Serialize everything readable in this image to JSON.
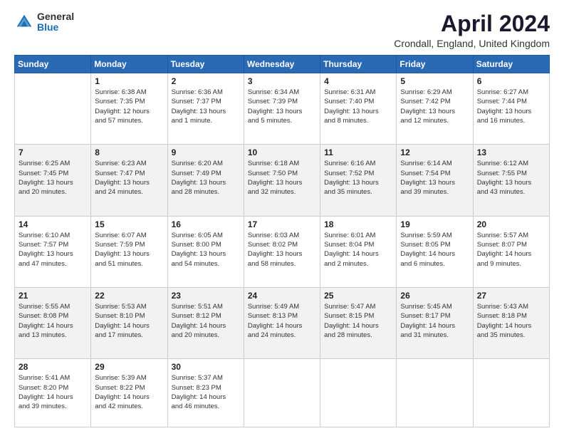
{
  "header": {
    "logo_general": "General",
    "logo_blue": "Blue",
    "title": "April 2024",
    "location": "Crondall, England, United Kingdom"
  },
  "weekdays": [
    "Sunday",
    "Monday",
    "Tuesday",
    "Wednesday",
    "Thursday",
    "Friday",
    "Saturday"
  ],
  "weeks": [
    [
      {
        "day": "",
        "info": ""
      },
      {
        "day": "1",
        "info": "Sunrise: 6:38 AM\nSunset: 7:35 PM\nDaylight: 12 hours\nand 57 minutes."
      },
      {
        "day": "2",
        "info": "Sunrise: 6:36 AM\nSunset: 7:37 PM\nDaylight: 13 hours\nand 1 minute."
      },
      {
        "day": "3",
        "info": "Sunrise: 6:34 AM\nSunset: 7:39 PM\nDaylight: 13 hours\nand 5 minutes."
      },
      {
        "day": "4",
        "info": "Sunrise: 6:31 AM\nSunset: 7:40 PM\nDaylight: 13 hours\nand 8 minutes."
      },
      {
        "day": "5",
        "info": "Sunrise: 6:29 AM\nSunset: 7:42 PM\nDaylight: 13 hours\nand 12 minutes."
      },
      {
        "day": "6",
        "info": "Sunrise: 6:27 AM\nSunset: 7:44 PM\nDaylight: 13 hours\nand 16 minutes."
      }
    ],
    [
      {
        "day": "7",
        "info": "Sunrise: 6:25 AM\nSunset: 7:45 PM\nDaylight: 13 hours\nand 20 minutes."
      },
      {
        "day": "8",
        "info": "Sunrise: 6:23 AM\nSunset: 7:47 PM\nDaylight: 13 hours\nand 24 minutes."
      },
      {
        "day": "9",
        "info": "Sunrise: 6:20 AM\nSunset: 7:49 PM\nDaylight: 13 hours\nand 28 minutes."
      },
      {
        "day": "10",
        "info": "Sunrise: 6:18 AM\nSunset: 7:50 PM\nDaylight: 13 hours\nand 32 minutes."
      },
      {
        "day": "11",
        "info": "Sunrise: 6:16 AM\nSunset: 7:52 PM\nDaylight: 13 hours\nand 35 minutes."
      },
      {
        "day": "12",
        "info": "Sunrise: 6:14 AM\nSunset: 7:54 PM\nDaylight: 13 hours\nand 39 minutes."
      },
      {
        "day": "13",
        "info": "Sunrise: 6:12 AM\nSunset: 7:55 PM\nDaylight: 13 hours\nand 43 minutes."
      }
    ],
    [
      {
        "day": "14",
        "info": "Sunrise: 6:10 AM\nSunset: 7:57 PM\nDaylight: 13 hours\nand 47 minutes."
      },
      {
        "day": "15",
        "info": "Sunrise: 6:07 AM\nSunset: 7:59 PM\nDaylight: 13 hours\nand 51 minutes."
      },
      {
        "day": "16",
        "info": "Sunrise: 6:05 AM\nSunset: 8:00 PM\nDaylight: 13 hours\nand 54 minutes."
      },
      {
        "day": "17",
        "info": "Sunrise: 6:03 AM\nSunset: 8:02 PM\nDaylight: 13 hours\nand 58 minutes."
      },
      {
        "day": "18",
        "info": "Sunrise: 6:01 AM\nSunset: 8:04 PM\nDaylight: 14 hours\nand 2 minutes."
      },
      {
        "day": "19",
        "info": "Sunrise: 5:59 AM\nSunset: 8:05 PM\nDaylight: 14 hours\nand 6 minutes."
      },
      {
        "day": "20",
        "info": "Sunrise: 5:57 AM\nSunset: 8:07 PM\nDaylight: 14 hours\nand 9 minutes."
      }
    ],
    [
      {
        "day": "21",
        "info": "Sunrise: 5:55 AM\nSunset: 8:08 PM\nDaylight: 14 hours\nand 13 minutes."
      },
      {
        "day": "22",
        "info": "Sunrise: 5:53 AM\nSunset: 8:10 PM\nDaylight: 14 hours\nand 17 minutes."
      },
      {
        "day": "23",
        "info": "Sunrise: 5:51 AM\nSunset: 8:12 PM\nDaylight: 14 hours\nand 20 minutes."
      },
      {
        "day": "24",
        "info": "Sunrise: 5:49 AM\nSunset: 8:13 PM\nDaylight: 14 hours\nand 24 minutes."
      },
      {
        "day": "25",
        "info": "Sunrise: 5:47 AM\nSunset: 8:15 PM\nDaylight: 14 hours\nand 28 minutes."
      },
      {
        "day": "26",
        "info": "Sunrise: 5:45 AM\nSunset: 8:17 PM\nDaylight: 14 hours\nand 31 minutes."
      },
      {
        "day": "27",
        "info": "Sunrise: 5:43 AM\nSunset: 8:18 PM\nDaylight: 14 hours\nand 35 minutes."
      }
    ],
    [
      {
        "day": "28",
        "info": "Sunrise: 5:41 AM\nSunset: 8:20 PM\nDaylight: 14 hours\nand 39 minutes."
      },
      {
        "day": "29",
        "info": "Sunrise: 5:39 AM\nSunset: 8:22 PM\nDaylight: 14 hours\nand 42 minutes."
      },
      {
        "day": "30",
        "info": "Sunrise: 5:37 AM\nSunset: 8:23 PM\nDaylight: 14 hours\nand 46 minutes."
      },
      {
        "day": "",
        "info": ""
      },
      {
        "day": "",
        "info": ""
      },
      {
        "day": "",
        "info": ""
      },
      {
        "day": "",
        "info": ""
      }
    ]
  ]
}
